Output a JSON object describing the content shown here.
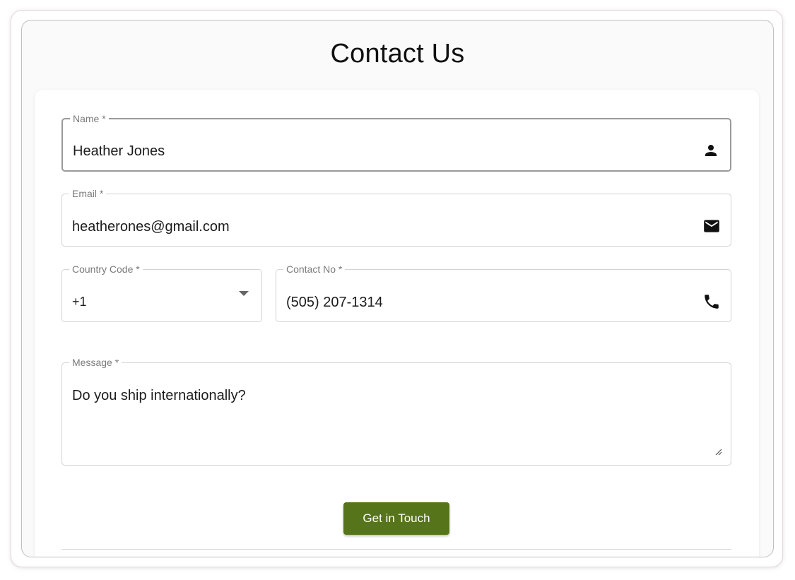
{
  "page": {
    "title": "Contact Us"
  },
  "form": {
    "name": {
      "label": "Name *",
      "value": "Heather Jones",
      "icon": "person-icon"
    },
    "email": {
      "label": "Email *",
      "value": "heatherones@gmail.com",
      "icon": "mail-icon"
    },
    "country_code": {
      "label": "Country Code *",
      "value": "+1",
      "icon": "dropdown-arrow-icon"
    },
    "contact_no": {
      "label": "Contact No *",
      "value": "(505) 207-1314",
      "icon": "phone-icon"
    },
    "message": {
      "label": "Message *",
      "value": "Do you ship internationally?"
    },
    "submit_label": "Get in Touch"
  },
  "colors": {
    "accent": "#56741a",
    "border": "#d3d3d3",
    "focused_border": "#9a9a9a",
    "label": "#7a7a7a"
  }
}
